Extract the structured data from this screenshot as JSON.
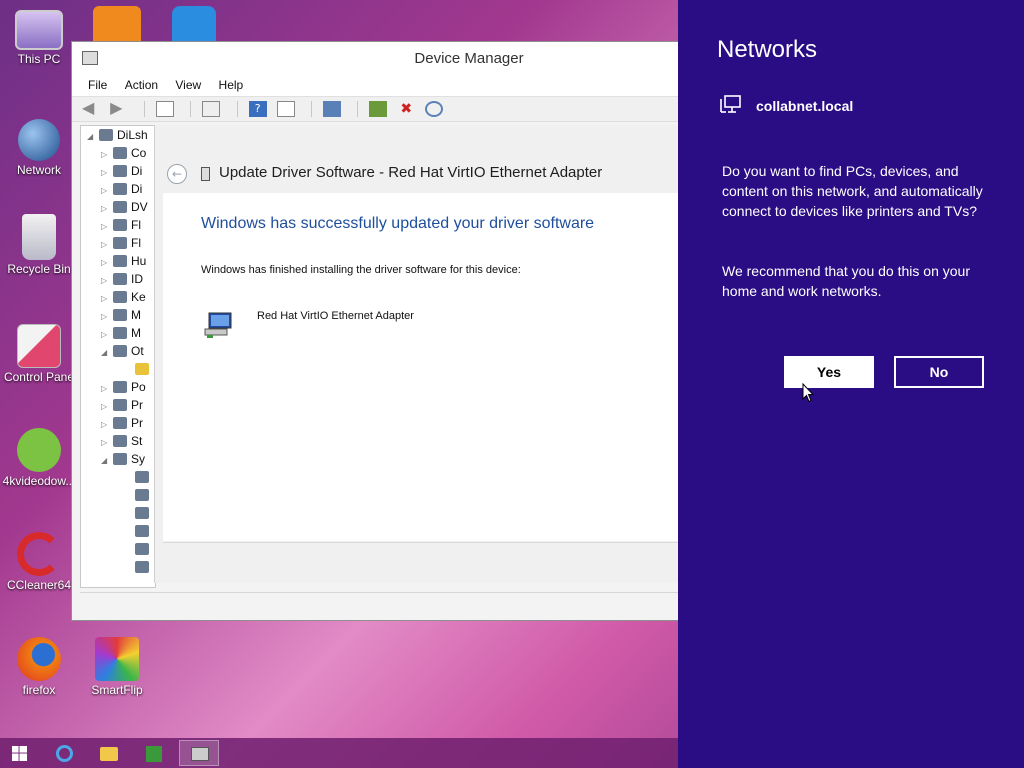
{
  "desktop": {
    "icons": [
      {
        "label": "This PC",
        "icon": "computer-icon"
      },
      {
        "label": "Network",
        "icon": "network-globe-icon"
      },
      {
        "label": "Recycle Bin",
        "icon": "recycle-bin-icon"
      },
      {
        "label": "Control Pane",
        "icon": "control-panel-icon"
      },
      {
        "label": "4kvideodow...",
        "icon": "download-cloud-icon"
      },
      {
        "label": "CCleaner64",
        "icon": "ccleaner-icon"
      },
      {
        "label": "firefox",
        "icon": "firefox-icon"
      },
      {
        "label": "SmartFlip",
        "icon": "smartflip-icon"
      }
    ]
  },
  "device_manager": {
    "title": "Device Manager",
    "menu": [
      "File",
      "Action",
      "View",
      "Help"
    ],
    "tree_root": "DiLsh",
    "tree_items": [
      {
        "label": "Co",
        "expanded": false
      },
      {
        "label": "Di",
        "expanded": false
      },
      {
        "label": "Di",
        "expanded": false
      },
      {
        "label": "DV",
        "expanded": false
      },
      {
        "label": "Fl",
        "expanded": false
      },
      {
        "label": "Fl",
        "expanded": false
      },
      {
        "label": "Hu",
        "expanded": false
      },
      {
        "label": "ID",
        "expanded": false
      },
      {
        "label": "Ke",
        "expanded": false
      },
      {
        "label": "M",
        "expanded": false
      },
      {
        "label": "M",
        "expanded": false
      },
      {
        "label": "Ot",
        "expanded": true
      },
      {
        "label": "",
        "expanded": false
      },
      {
        "label": "Po",
        "expanded": false
      },
      {
        "label": "Pr",
        "expanded": false
      },
      {
        "label": "Pr",
        "expanded": false
      },
      {
        "label": "St",
        "expanded": false
      },
      {
        "label": "Sy",
        "expanded": true
      }
    ]
  },
  "update_driver": {
    "title": "Update Driver Software - Red Hat VirtIO Ethernet Adapter",
    "heading": "Windows has successfully updated your driver software",
    "message": "Windows has finished installing the driver software for this device:",
    "device_name": "Red Hat VirtIO Ethernet Adapter"
  },
  "networks": {
    "title": "Networks",
    "network_name": "collabnet.local",
    "question": "Do you want to find PCs, devices, and content on this network, and automatically connect to devices like printers and TVs?",
    "recommendation": "We recommend that you do this on your home and work networks.",
    "yes_label": "Yes",
    "no_label": "No"
  },
  "colors": {
    "charm_bg": "#2a0d85",
    "heading_blue": "#1f4e9c"
  }
}
